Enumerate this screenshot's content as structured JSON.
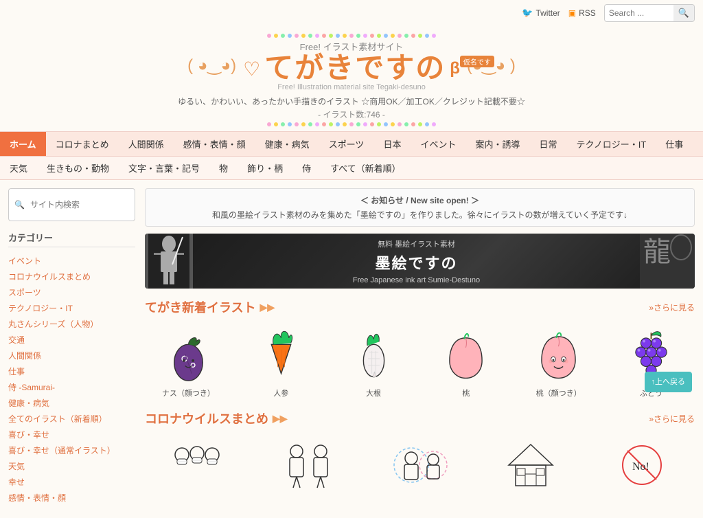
{
  "topbar": {
    "twitter_label": "Twitter",
    "rss_label": "RSS",
    "search_placeholder": "Search ...",
    "search_btn_label": "🔍"
  },
  "header": {
    "free_label": "Free! イラスト素材サイト",
    "title_main": "てがきですの",
    "beta_label": "仮名です",
    "sub_label": "Free! Illustration material site Tegaki-desuno",
    "tagline": "ゆるい、かわいい、あったかい手描きのイラスト ☆商用OK／加工OK／クレジット記載不要☆",
    "count": "- イラスト数:746 -"
  },
  "nav_primary": {
    "items": [
      {
        "label": "ホーム",
        "active": true
      },
      {
        "label": "コロナまとめ",
        "active": false
      },
      {
        "label": "人間関係",
        "active": false
      },
      {
        "label": "感情・表情・顔",
        "active": false
      },
      {
        "label": "健康・病気",
        "active": false
      },
      {
        "label": "スポーツ",
        "active": false
      },
      {
        "label": "日本",
        "active": false
      },
      {
        "label": "イベント",
        "active": false
      },
      {
        "label": "案内・誘導",
        "active": false
      },
      {
        "label": "日常",
        "active": false
      },
      {
        "label": "テクノロジー・IT",
        "active": false
      },
      {
        "label": "仕事",
        "active": false
      }
    ]
  },
  "nav_secondary": {
    "items": [
      {
        "label": "天気"
      },
      {
        "label": "生きもの・動物"
      },
      {
        "label": "文字・言葉・記号"
      },
      {
        "label": "物"
      },
      {
        "label": "飾り・柄"
      },
      {
        "label": "侍"
      },
      {
        "label": "すべて（新着順）"
      }
    ]
  },
  "sidebar": {
    "search_placeholder": "サイト内検索",
    "search_btn": "検索",
    "category_title": "カテゴリー",
    "categories": [
      "イベント",
      "コロナウイルスまとめ",
      "スポーツ",
      "テクノロジー・IT",
      "丸さんシリーズ（人物）",
      "交通",
      "人間関係",
      "仕事",
      "侍 -Samurai-",
      "健康・病気",
      "全てのイラスト（新着順）",
      "喜び・幸せ",
      "喜び・幸せ（通常イラスト）",
      "天気",
      "幸せ",
      "感情・表情・顔"
    ]
  },
  "notice": {
    "title": "＜ お知らせ / New site open! ＞",
    "text": "和風の墨絵イラスト素材のみを集めた「墨絵ですの」を作りました。徐々にイラストの数が増えていく予定です↓"
  },
  "banner": {
    "label_free": "無料 墨絵イラスト素材",
    "title": "墨絵ですの",
    "subtitle": "Free Japanese ink art  Sumie-Destuno"
  },
  "section_new": {
    "title": "てがき新着イラスト",
    "more": "»さらに見る",
    "items": [
      {
        "label": "ナス（顔つき）"
      },
      {
        "label": "人参"
      },
      {
        "label": "大根"
      },
      {
        "label": "桃"
      },
      {
        "label": "桃（顔つき）"
      },
      {
        "label": "ぶどう"
      }
    ]
  },
  "section_corona": {
    "title": "コロナウイルスまとめ",
    "more": "»さらに見る"
  },
  "scroll_top": {
    "label": "↑上へ戻る"
  },
  "dots_colors": [
    "#f9a8d4",
    "#fcd34d",
    "#86efac",
    "#93c5fd",
    "#f9a8d4",
    "#fcd34d",
    "#86efac",
    "#f0abfc",
    "#fca5a5",
    "#bef264",
    "#93c5fd",
    "#fcd34d",
    "#f9a8d4",
    "#86efac",
    "#f0abfc",
    "#fca5a5",
    "#bef264",
    "#93c5fd",
    "#fcd34d",
    "#f9a8d4",
    "#86efac",
    "#fca5a5",
    "#bef264",
    "#93c5fd",
    "#f0abfc"
  ]
}
